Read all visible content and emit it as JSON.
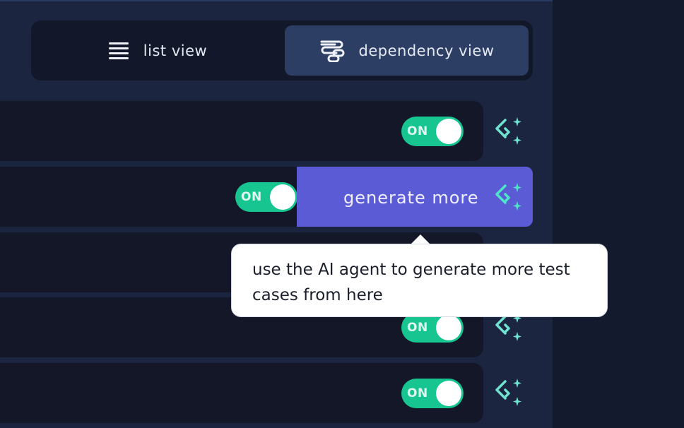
{
  "view_toggle": {
    "list_view_label": "list view",
    "dependency_view_label": "dependency view",
    "active": "dependency view"
  },
  "rows": [
    {
      "switch_label": "ON",
      "switch_state": "on"
    },
    {
      "switch_label": "ON",
      "switch_state": "on",
      "action_label": "generate more"
    },
    {
      "switch_label": "",
      "switch_state": "hidden-by-tooltip"
    },
    {
      "switch_label": "ON",
      "switch_state": "on"
    },
    {
      "switch_label": "ON",
      "switch_state": "on"
    }
  ],
  "tooltip": {
    "line1": "use the AI agent to generate more test",
    "line2": "cases from here"
  },
  "icons": {
    "list": "list-icon",
    "dependency": "dependency-icon",
    "ai": "ai-sparkle-icon"
  },
  "colors": {
    "switch_on": "#17c590",
    "accent_purple": "#5b5bd6",
    "ai_icon": "#6fe3cf",
    "panel_bg": "#1c2540",
    "row_bg": "#131728"
  }
}
